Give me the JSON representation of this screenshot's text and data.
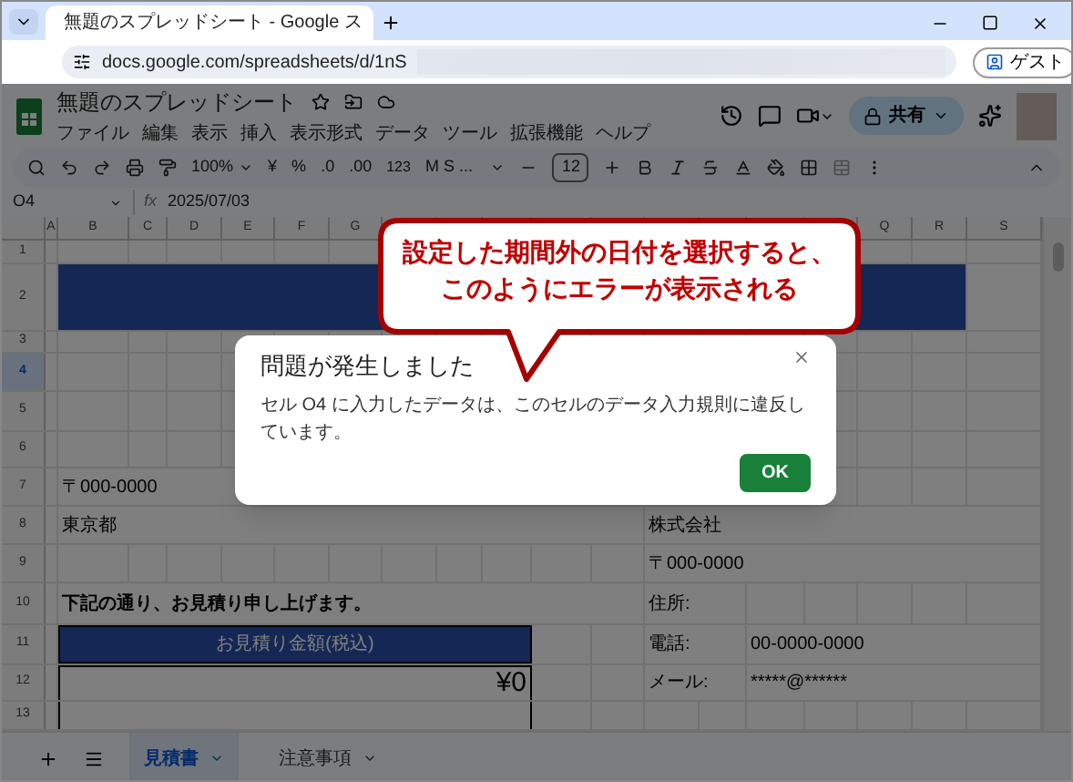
{
  "browser": {
    "tab_title": "無題のスプレッドシート - Google ス",
    "url": "docs.google.com/spreadsheets/d/1nS",
    "profile": "ゲスト"
  },
  "doc": {
    "title": "無題のスプレッドシート",
    "menus": [
      "ファイル",
      "編集",
      "表示",
      "挿入",
      "表示形式",
      "データ",
      "ツール",
      "拡張機能",
      "ヘルプ"
    ],
    "share": "共有"
  },
  "toolbar": {
    "zoom": "100%",
    "currency": "¥",
    "percent": "%",
    "decrease_decimals": ".0",
    "increase_decimals": ".00",
    "number_format": "123",
    "font": "M S ...",
    "font_size": "12"
  },
  "formula_bar": {
    "cell": "O4",
    "fx": "fx",
    "value": "2025/07/03"
  },
  "column_headers": {
    "left": [
      "A",
      "B",
      "C",
      "D",
      "E",
      "F",
      "G"
    ],
    "right": [
      "Q",
      "R",
      "S"
    ]
  },
  "rows": [
    {
      "number": "1",
      "selected": false
    },
    {
      "number": "2",
      "selected": false,
      "cells": [
        {
          "kind": "banner"
        }
      ]
    },
    {
      "number": "3",
      "selected": false
    },
    {
      "number": "4",
      "selected": true
    },
    {
      "number": "5",
      "selected": false
    },
    {
      "number": "6",
      "selected": false
    },
    {
      "number": "7",
      "selected": false,
      "cells": [
        {
          "kind": "text",
          "text": "〒000-0000"
        }
      ]
    },
    {
      "number": "8",
      "selected": false,
      "cells": [
        {
          "kind": "text",
          "text": "東京都"
        },
        {
          "kind": "right",
          "text": "株式会社"
        }
      ]
    },
    {
      "number": "9",
      "selected": false,
      "cells": [
        {
          "kind": "right",
          "text": "〒000-0000"
        }
      ]
    },
    {
      "number": "10",
      "selected": false,
      "cells": [
        {
          "kind": "note",
          "text": "下記の通り、お見積り申し上げます。"
        },
        {
          "kind": "label",
          "text": "住所:"
        }
      ]
    },
    {
      "number": "11",
      "selected": false,
      "cells": [
        {
          "kind": "heading",
          "text": "お見積り金額(税込)"
        },
        {
          "kind": "label",
          "text": "電話:"
        },
        {
          "kind": "value",
          "text": "00-0000-0000"
        }
      ]
    },
    {
      "number": "12",
      "selected": false,
      "cells": [
        {
          "kind": "amount",
          "text": "¥0"
        },
        {
          "kind": "label",
          "text": "メール:"
        },
        {
          "kind": "value",
          "text": "*****@******"
        }
      ]
    },
    {
      "number": "13",
      "selected": false,
      "cells": [
        {
          "kind": "box"
        }
      ]
    }
  ],
  "sheet_tabs": [
    {
      "label": "見積書",
      "selected": true
    },
    {
      "label": "注意事項",
      "selected": false
    }
  ],
  "dialog": {
    "title": "問題が発生しました",
    "message": "セル O4 に入力したデータは、このセルのデータ入力規則に違反しています。",
    "button": "OK"
  },
  "callout": {
    "lines": [
      "設定した期間外の日付を選択すると、",
      "このようにエラーが表示される"
    ]
  }
}
